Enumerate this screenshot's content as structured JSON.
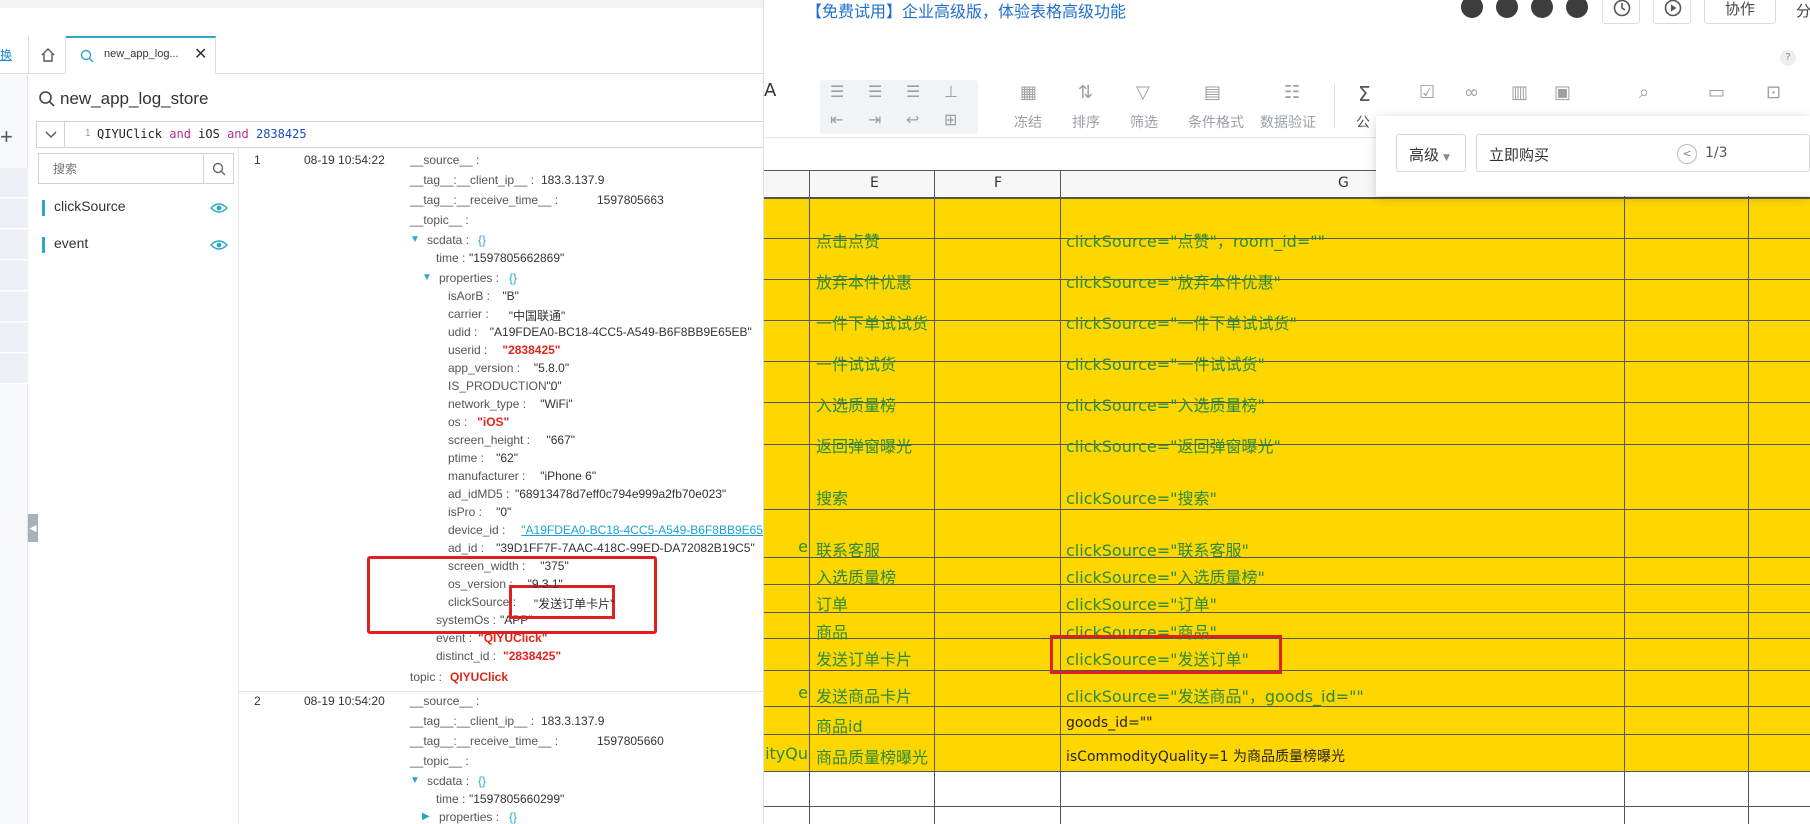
{
  "left_panel": {
    "side_link": "换",
    "tab_label": "new_app_log...",
    "logstore_title": "new_app_log_store",
    "query": {
      "line_no": "1",
      "t1": "QIYUClick ",
      "and1": "and",
      "t2": " iOS ",
      "and2": "and",
      "t3": " 2838425"
    },
    "search_placeholder": "搜索",
    "fields": [
      "clickSource",
      "event"
    ],
    "log1": {
      "index": "1",
      "time": "08-19 10:54:22",
      "source_key": "__source__ :",
      "client_ip_key": "__tag__:__client_ip__ :",
      "client_ip_val": "183.3.137.9",
      "receive_key": "__tag__:__receive_time__ :",
      "receive_val": "1597805663",
      "topic_key": "__topic__ :",
      "scdata_key": "scdata :",
      "brace": "{}",
      "sc_time_key": "time :",
      "sc_time_val": "\"1597805662869\"",
      "props_key": "properties :",
      "props": [
        {
          "k": "isAorB :",
          "v": "\"B\""
        },
        {
          "k": "carrier :",
          "v": "\"中国联通\""
        },
        {
          "k": "udid :",
          "v": "\"A19FDEA0-BC18-4CC5-A549-B6F8BB9E65EB\""
        },
        {
          "k": "userid :",
          "v": "\"2838425\""
        },
        {
          "k": "app_version :",
          "v": "\"5.8.0\""
        },
        {
          "k": "IS_PRODUCTION :",
          "v": "\"0\""
        },
        {
          "k": "network_type :",
          "v": "\"WiFi\""
        },
        {
          "k": "os :",
          "v": "\"iOS\""
        },
        {
          "k": "screen_height :",
          "v": "\"667\""
        },
        {
          "k": "ptime :",
          "v": "\"62\""
        },
        {
          "k": "manufacturer :",
          "v": "\"iPhone 6\""
        },
        {
          "k": "ad_idMD5 :",
          "v": "\"68913478d7eff0c794e999a2fb70e023\""
        },
        {
          "k": "isPro :",
          "v": "\"0\""
        },
        {
          "k": "device_id :",
          "v": "\"A19FDEA0-BC18-4CC5-A549-B6F8BB9E65EB\""
        },
        {
          "k": "ad_id :",
          "v": "\"39D1FF7F-7AAC-418C-99ED-DA72082B19C5\""
        },
        {
          "k": "screen_width :",
          "v": "\"375\""
        },
        {
          "k": "os_version :",
          "v": "\"9.3.1\""
        },
        {
          "k": "clickSource :",
          "v": "\"发送订单卡片\""
        }
      ],
      "systemOs_key": "systemOs :",
      "systemOs_val": "\"APP\"",
      "event_key": "event :",
      "event_val": "\"QIYUClick\"",
      "distinct_key": "distinct_id :",
      "distinct_val": "\"2838425\"",
      "topic2_key": "topic :",
      "topic2_val": "QIYUClick"
    },
    "log2": {
      "index": "2",
      "time": "08-19 10:54:20",
      "source_key": "__source__ :",
      "client_ip_key": "__tag__:__client_ip__ :",
      "client_ip_val": "183.3.137.9",
      "receive_key": "__tag__:__receive_time__ :",
      "receive_val": "1597805660",
      "topic_key": "__topic__ :",
      "scdata_key": "scdata :",
      "brace": "{}",
      "sc_time_key": "time :",
      "sc_time_val": "\"1597805660299\"",
      "props_key": "properties :"
    }
  },
  "sheet": {
    "promo": "【免费试用】企业高级版，体验表格高级功能",
    "collab_label": "协作",
    "share_label": "分",
    "help": "?",
    "toolbar": {
      "freeze": "冻结",
      "sort": "排序",
      "filter": "筛选",
      "cond_format": "条件格式",
      "validate": "数据验证",
      "formula": "公"
    },
    "find": {
      "mode": "高级",
      "query": "立即购买",
      "count": "1/3"
    },
    "col_headers": {
      "E": "E",
      "F": "F",
      "G": "G"
    },
    "rows": [
      {
        "e": "点击点赞",
        "g": "clickSource=\"点赞\"，room_id=\"\""
      },
      {
        "e": "放弃本件优惠",
        "g": "clickSource=\"放弃本件优惠\""
      },
      {
        "e": "一件下单试试货",
        "g": "clickSource=\"一件下单试试货\""
      },
      {
        "e": "一件试试货",
        "g": "clickSource=\"一件试试货\""
      },
      {
        "e": "入选质量榜",
        "g": "clickSource=\"入选质量榜\""
      },
      {
        "e": "返回弹窗曝光",
        "g": "clickSource=\"返回弹窗曝光\""
      },
      {
        "e": "搜索",
        "g": "clickSource=\"搜索\""
      },
      {
        "e": "联系客服",
        "g": "clickSource=\"联系客服\"",
        "d": "e"
      },
      {
        "e": "入选质量榜",
        "g": "clickSource=\"入选质量榜\""
      },
      {
        "e": "订单",
        "g": "clickSource=\"订单\""
      },
      {
        "e": "商品",
        "g": "clickSource=\"商品\""
      },
      {
        "e": "发送订单卡片",
        "g": "clickSource=\"发送订单\""
      },
      {
        "e": "发送商品卡片",
        "g": "clickSource=\"发送商品\"，goods_id=\"\"",
        "d": "e"
      },
      {
        "e": "商品id",
        "g": "goods_id=\"\""
      },
      {
        "e": "商品质量榜曝光",
        "g": "isCommodityQuality=1 为商品质量榜曝光",
        "d": "dityQu"
      }
    ]
  },
  "colors": {
    "yellow": "#ffd700",
    "cell_text": "#2b8a3a",
    "accent": "#2aa8c8",
    "highlight": "#e02020"
  }
}
